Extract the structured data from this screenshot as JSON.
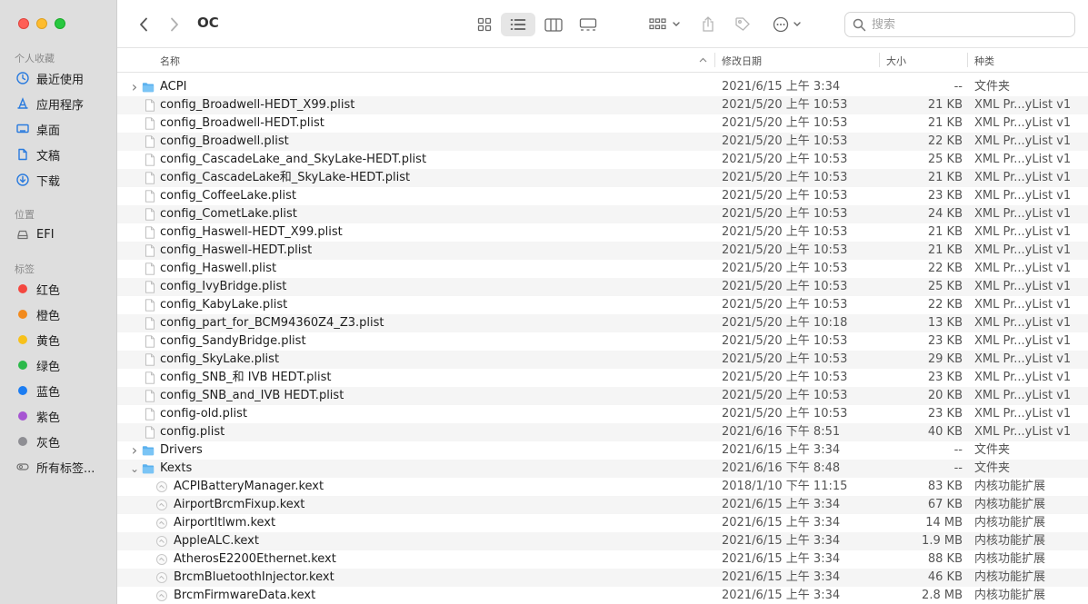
{
  "window": {
    "title": "OC"
  },
  "toolbar": {
    "back_icon": "chevron-left-icon",
    "forward_icon": "chevron-right-icon",
    "search_placeholder": "搜索"
  },
  "sidebar": {
    "favorites_label": "个人收藏",
    "favorites": [
      {
        "label": "最近使用",
        "icon": "clock-icon"
      },
      {
        "label": "应用程序",
        "icon": "apps-icon"
      },
      {
        "label": "桌面",
        "icon": "desktop-icon"
      },
      {
        "label": "文稿",
        "icon": "document-icon"
      },
      {
        "label": "下载",
        "icon": "download-icon"
      }
    ],
    "locations_label": "位置",
    "locations": [
      {
        "label": "EFI",
        "icon": "drive-icon"
      }
    ],
    "tags_label": "标签",
    "tags": [
      {
        "label": "红色",
        "color": "#f4473f"
      },
      {
        "label": "橙色",
        "color": "#f28a1d"
      },
      {
        "label": "黄色",
        "color": "#f7c11b"
      },
      {
        "label": "绿色",
        "color": "#2bb94a"
      },
      {
        "label": "蓝色",
        "color": "#1c7df2"
      },
      {
        "label": "紫色",
        "color": "#a655d2"
      },
      {
        "label": "灰色",
        "color": "#8e8e93"
      }
    ],
    "all_tags_label": "所有标签..."
  },
  "columns": {
    "name": "名称",
    "date": "修改日期",
    "size": "大小",
    "kind": "种类"
  },
  "files": [
    {
      "name": "ACPI",
      "date": "2021/6/15 上午 3:34",
      "size": "--",
      "kind": "文件夹",
      "type": "folder",
      "expand": "closed",
      "indent": 0
    },
    {
      "name": "config_Broadwell-HEDT_X99.plist",
      "date": "2021/5/20 上午 10:53",
      "size": "21 KB",
      "kind": "XML Pr...yList v1",
      "type": "file",
      "indent": 0
    },
    {
      "name": "config_Broadwell-HEDT.plist",
      "date": "2021/5/20 上午 10:53",
      "size": "21 KB",
      "kind": "XML Pr...yList v1",
      "type": "file",
      "indent": 0
    },
    {
      "name": "config_Broadwell.plist",
      "date": "2021/5/20 上午 10:53",
      "size": "22 KB",
      "kind": "XML Pr...yList v1",
      "type": "file",
      "indent": 0
    },
    {
      "name": "config_CascadeLake_and_SkyLake-HEDT.plist",
      "date": "2021/5/20 上午 10:53",
      "size": "25 KB",
      "kind": "XML Pr...yList v1",
      "type": "file",
      "indent": 0
    },
    {
      "name": "config_CascadeLake和_SkyLake-HEDT.plist",
      "date": "2021/5/20 上午 10:53",
      "size": "21 KB",
      "kind": "XML Pr...yList v1",
      "type": "file",
      "indent": 0
    },
    {
      "name": "config_CoffeeLake.plist",
      "date": "2021/5/20 上午 10:53",
      "size": "23 KB",
      "kind": "XML Pr...yList v1",
      "type": "file",
      "indent": 0
    },
    {
      "name": "config_CometLake.plist",
      "date": "2021/5/20 上午 10:53",
      "size": "24 KB",
      "kind": "XML Pr...yList v1",
      "type": "file",
      "indent": 0
    },
    {
      "name": "config_Haswell-HEDT_X99.plist",
      "date": "2021/5/20 上午 10:53",
      "size": "21 KB",
      "kind": "XML Pr...yList v1",
      "type": "file",
      "indent": 0
    },
    {
      "name": "config_Haswell-HEDT.plist",
      "date": "2021/5/20 上午 10:53",
      "size": "21 KB",
      "kind": "XML Pr...yList v1",
      "type": "file",
      "indent": 0
    },
    {
      "name": "config_Haswell.plist",
      "date": "2021/5/20 上午 10:53",
      "size": "22 KB",
      "kind": "XML Pr...yList v1",
      "type": "file",
      "indent": 0
    },
    {
      "name": "config_IvyBridge.plist",
      "date": "2021/5/20 上午 10:53",
      "size": "25 KB",
      "kind": "XML Pr...yList v1",
      "type": "file",
      "indent": 0
    },
    {
      "name": "config_KabyLake.plist",
      "date": "2021/5/20 上午 10:53",
      "size": "22 KB",
      "kind": "XML Pr...yList v1",
      "type": "file",
      "indent": 0
    },
    {
      "name": "config_part_for_BCM94360Z4_Z3.plist",
      "date": "2021/5/20 上午 10:18",
      "size": "13 KB",
      "kind": "XML Pr...yList v1",
      "type": "file",
      "indent": 0
    },
    {
      "name": "config_SandyBridge.plist",
      "date": "2021/5/20 上午 10:53",
      "size": "23 KB",
      "kind": "XML Pr...yList v1",
      "type": "file",
      "indent": 0
    },
    {
      "name": "config_SkyLake.plist",
      "date": "2021/5/20 上午 10:53",
      "size": "29 KB",
      "kind": "XML Pr...yList v1",
      "type": "file",
      "indent": 0
    },
    {
      "name": "config_SNB_和 IVB HEDT.plist",
      "date": "2021/5/20 上午 10:53",
      "size": "23 KB",
      "kind": "XML Pr...yList v1",
      "type": "file",
      "indent": 0
    },
    {
      "name": "config_SNB_and_IVB HEDT.plist",
      "date": "2021/5/20 上午 10:53",
      "size": "20 KB",
      "kind": "XML Pr...yList v1",
      "type": "file",
      "indent": 0
    },
    {
      "name": "config-old.plist",
      "date": "2021/5/20 上午 10:53",
      "size": "23 KB",
      "kind": "XML Pr...yList v1",
      "type": "file",
      "indent": 0
    },
    {
      "name": "config.plist",
      "date": "2021/6/16 下午 8:51",
      "size": "40 KB",
      "kind": "XML Pr...yList v1",
      "type": "file",
      "indent": 0
    },
    {
      "name": "Drivers",
      "date": "2021/6/15 上午 3:34",
      "size": "--",
      "kind": "文件夹",
      "type": "folder",
      "expand": "closed",
      "indent": 0
    },
    {
      "name": "Kexts",
      "date": "2021/6/16 下午 8:48",
      "size": "--",
      "kind": "文件夹",
      "type": "folder",
      "expand": "open",
      "indent": 0
    },
    {
      "name": "ACPIBatteryManager.kext",
      "date": "2018/1/10 下午 11:15",
      "size": "83 KB",
      "kind": "内核功能扩展",
      "type": "kext",
      "indent": 1
    },
    {
      "name": "AirportBrcmFixup.kext",
      "date": "2021/6/15 上午 3:34",
      "size": "67 KB",
      "kind": "内核功能扩展",
      "type": "kext",
      "indent": 1
    },
    {
      "name": "AirportItlwm.kext",
      "date": "2021/6/15 上午 3:34",
      "size": "14 MB",
      "kind": "内核功能扩展",
      "type": "kext",
      "indent": 1
    },
    {
      "name": "AppleALC.kext",
      "date": "2021/6/15 上午 3:34",
      "size": "1.9 MB",
      "kind": "内核功能扩展",
      "type": "kext",
      "indent": 1
    },
    {
      "name": "AtherosE2200Ethernet.kext",
      "date": "2021/6/15 上午 3:34",
      "size": "88 KB",
      "kind": "内核功能扩展",
      "type": "kext",
      "indent": 1
    },
    {
      "name": "BrcmBluetoothInjector.kext",
      "date": "2021/6/15 上午 3:34",
      "size": "46 KB",
      "kind": "内核功能扩展",
      "type": "kext",
      "indent": 1
    },
    {
      "name": "BrcmFirmwareData.kext",
      "date": "2021/6/15 上午 3:34",
      "size": "2.8 MB",
      "kind": "内核功能扩展",
      "type": "kext",
      "indent": 1
    }
  ]
}
